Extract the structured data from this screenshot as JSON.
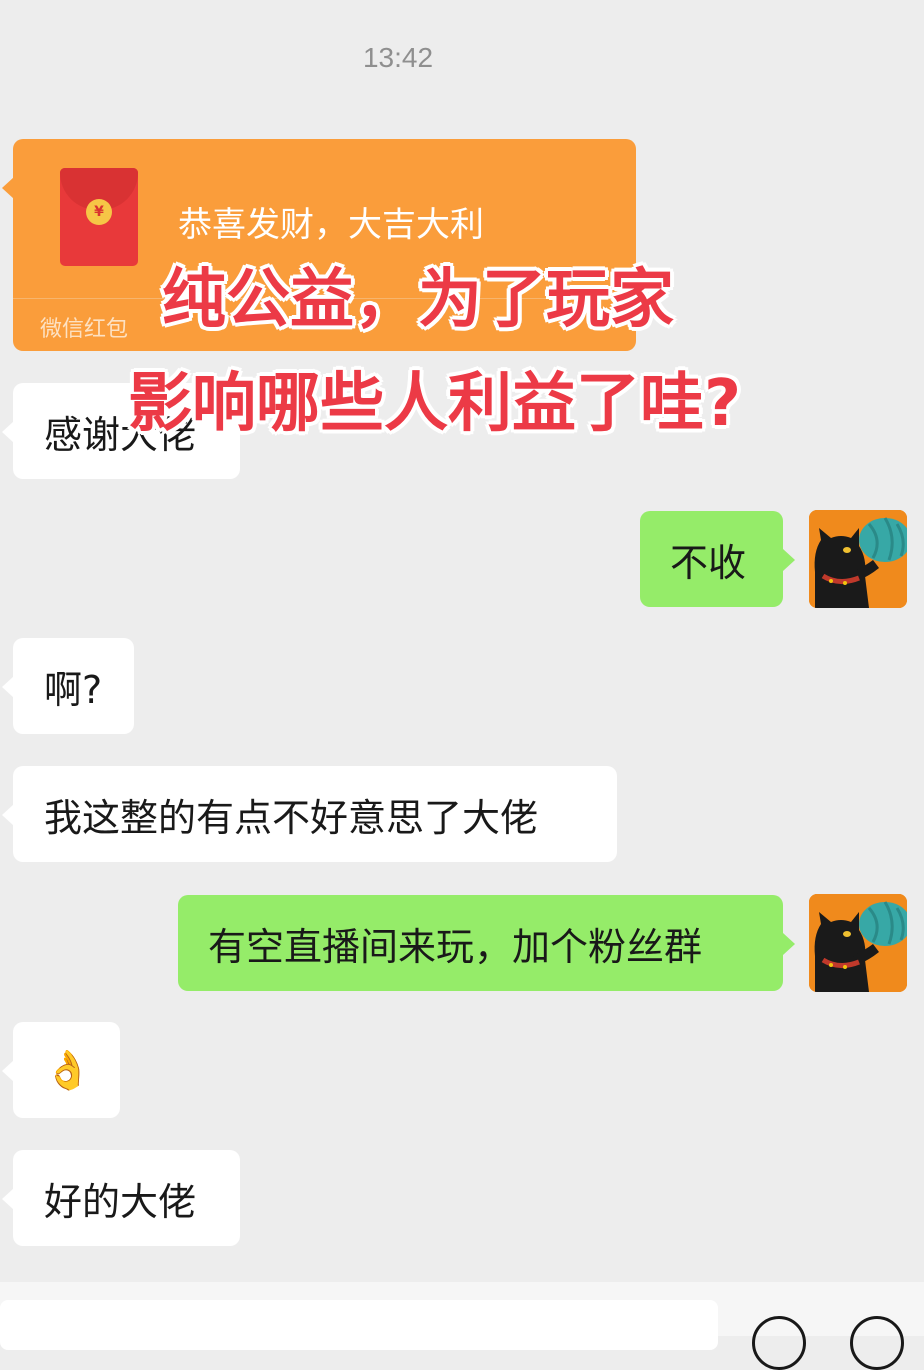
{
  "chat": {
    "timestamp": "13:42",
    "red_packet": {
      "title": "恭喜发财，大吉大利",
      "label": "微信红包",
      "coin_symbol": "¥"
    },
    "messages": [
      {
        "side": "left",
        "text": "感谢大佬"
      },
      {
        "side": "right",
        "text": "不收"
      },
      {
        "side": "left",
        "text": "啊?"
      },
      {
        "side": "left",
        "text": "我这整的有点不好意思了大佬"
      },
      {
        "side": "right",
        "text": "有空直播间来玩，加个粉丝群"
      },
      {
        "side": "left",
        "text": "👌"
      },
      {
        "side": "left",
        "text": "好的大佬"
      }
    ]
  },
  "overlay": {
    "line1": "纯公益，为了玩家",
    "line2": "影响哪些人利益了哇?"
  },
  "colors": {
    "background": "#ededed",
    "sent_bubble": "#95ec69",
    "received_bubble": "#ffffff",
    "red_packet": "#fa9d3b",
    "overlay_text": "#ec3a46"
  }
}
